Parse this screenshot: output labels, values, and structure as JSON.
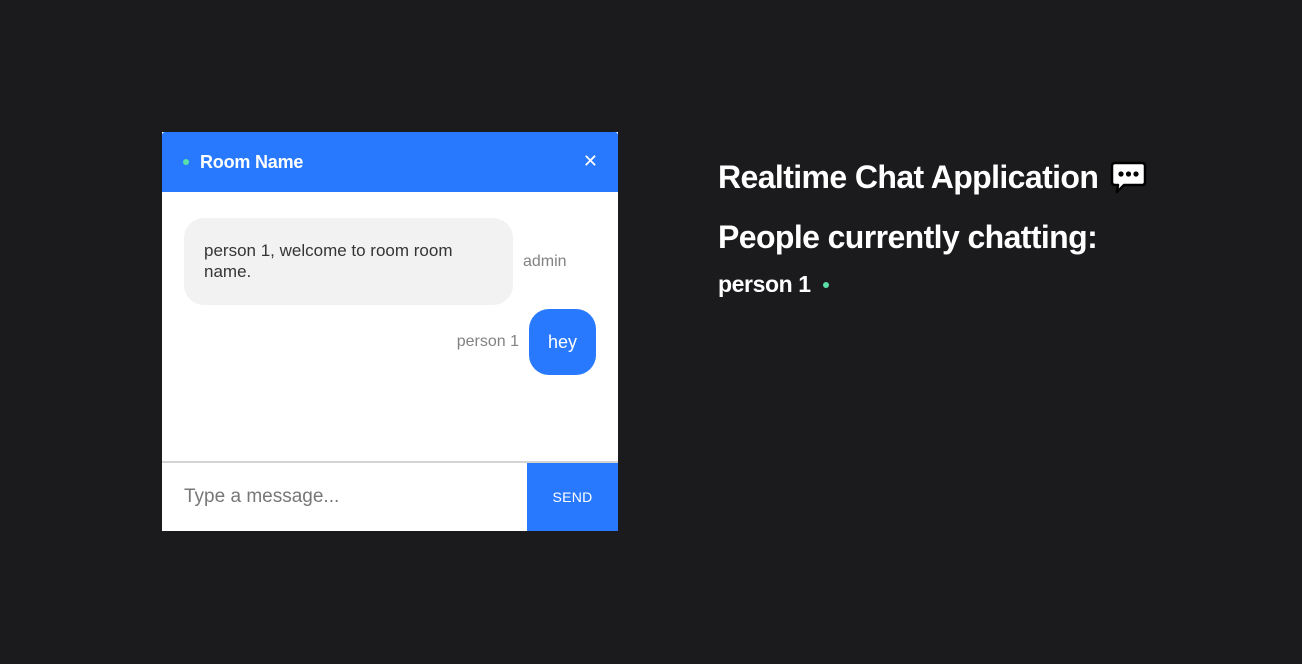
{
  "chat": {
    "room_name": "Room Name",
    "close_glyph": "✕",
    "messages": [
      {
        "text": "person 1, welcome to room room name.",
        "sender": "admin",
        "type": "received"
      },
      {
        "text": "hey",
        "sender": "person 1",
        "type": "sent"
      }
    ],
    "input_placeholder": "Type a message...",
    "input_value": "",
    "send_label": "SEND"
  },
  "sidebar": {
    "app_title": "Realtime Chat Application",
    "title_icon": "speech-bubble-icon",
    "people_heading": "People currently chatting:",
    "users": [
      {
        "name": "person 1",
        "status": "online"
      }
    ]
  },
  "colors": {
    "background": "#1b1b1d",
    "accent": "#2979ff",
    "online": "#5ae0a5",
    "received_bubble": "#f2f2f2"
  }
}
